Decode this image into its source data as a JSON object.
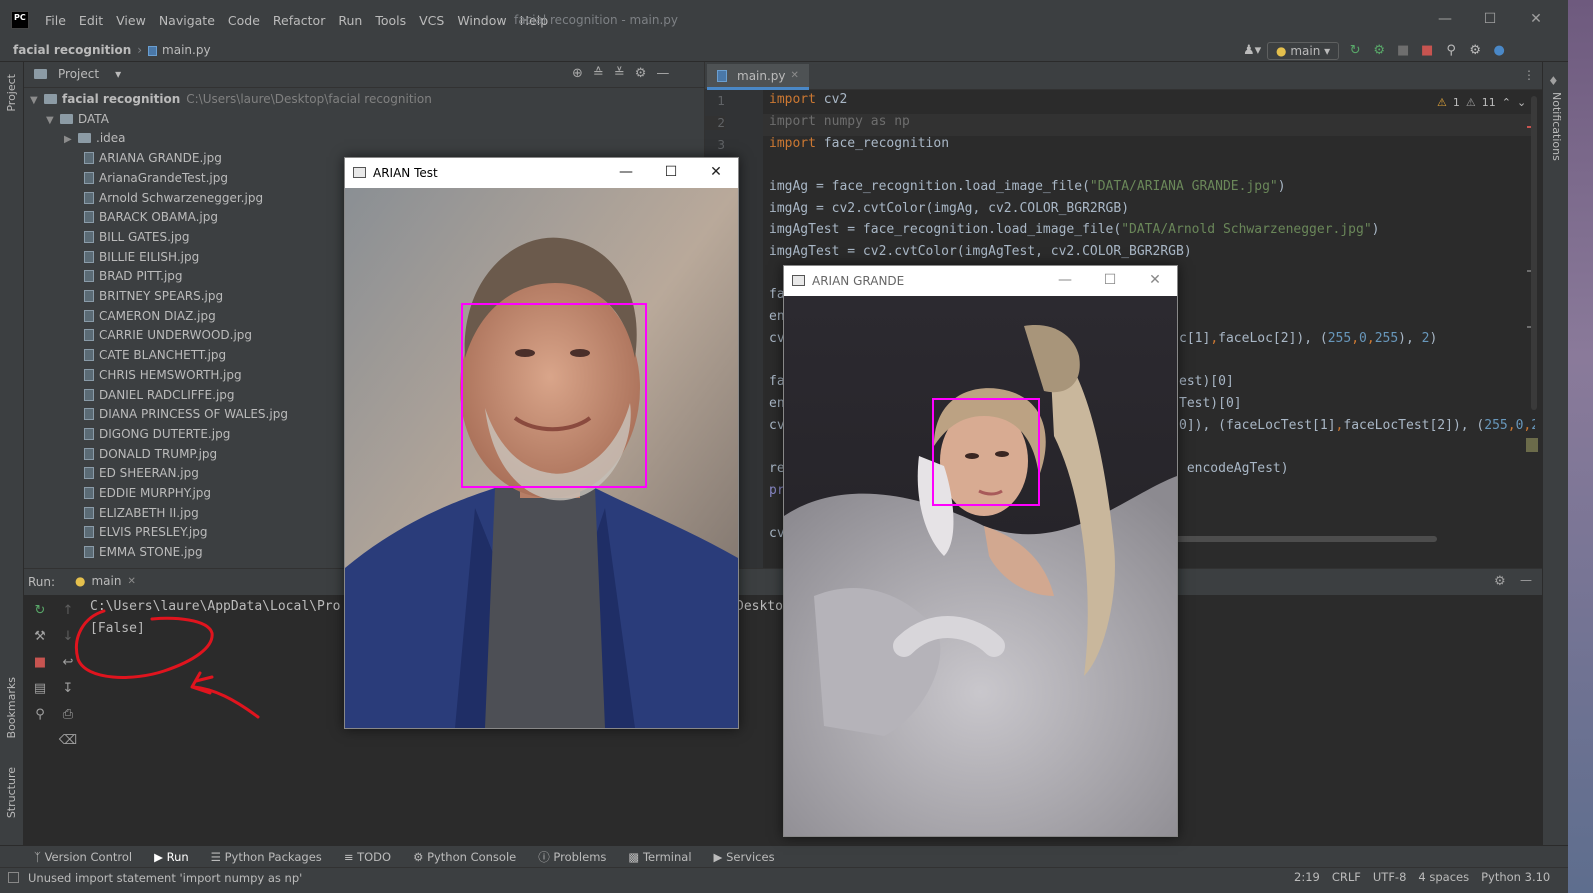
{
  "app": {
    "logo_text": "PC",
    "window_title": "facial recognition - main.py"
  },
  "menu": [
    "File",
    "Edit",
    "View",
    "Navigate",
    "Code",
    "Refactor",
    "Run",
    "Tools",
    "VCS",
    "Window",
    "Help"
  ],
  "breadcrumb": {
    "project": "facial recognition",
    "file": "main.py"
  },
  "toolbar": {
    "run_config": "main"
  },
  "left_strip": {
    "project": "Project",
    "bookmarks": "Bookmarks",
    "structure": "Structure"
  },
  "right_strip": {
    "notifications": "Notifications"
  },
  "project_panel": {
    "title": "Project",
    "root": {
      "name": "facial recognition",
      "path": "C:\\Users\\laure\\Desktop\\facial recognition"
    },
    "data_folder": "DATA",
    "idea_folder": ".idea",
    "files": [
      "ARIANA GRANDE.jpg",
      "ArianaGrandeTest.jpg",
      "Arnold Schwarzenegger.jpg",
      "BARACK OBAMA.jpg",
      "BILL GATES.jpg",
      "BILLIE EILISH.jpg",
      "BRAD PITT.jpg",
      "BRITNEY SPEARS.jpg",
      "CAMERON DIAZ.jpg",
      "CARRIE UNDERWOOD.jpg",
      "CATE BLANCHETT.jpg",
      "CHRIS HEMSWORTH.jpg",
      "DANIEL RADCLIFFE.jpg",
      "DIANA PRINCESS OF WALES.jpg",
      "DIGONG DUTERTE.jpg",
      "DONALD TRUMP.jpg",
      "ED SHEERAN.jpg",
      "EDDIE MURPHY.jpg",
      "ELIZABETH II.jpg",
      "ELVIS PRESLEY.jpg",
      "EMMA STONE.jpg"
    ]
  },
  "editor": {
    "tab": "main.py",
    "warnings": "1",
    "weak_warnings": "11",
    "line_numbers": [
      "1",
      "2",
      "3"
    ],
    "lines": {
      "l1": {
        "kw": "import",
        "rest": " cv2"
      },
      "l2": "import numpy as np",
      "l3": {
        "kw": "import",
        "rest": " face_recognition"
      },
      "l5": {
        "a": "imgAg = face_recognition.load_image_file(",
        "s": "\"DATA/ARIANA GRANDE.jpg\"",
        "b": ")"
      },
      "l6": "imgAg = cv2.cvtColor(imgAg, cv2.COLOR_BGR2RGB)",
      "l7": {
        "a": "imgAgTest = face_recognition.load_image_file(",
        "s": "\"DATA/Arnold Schwarzenegger.jpg\"",
        "b": ")"
      },
      "l8": "imgAgTest = cv2.cvtColor(imgAgTest, cv2.COLOR_BGR2RGB)",
      "l10": "fa",
      "l11": "en",
      "l12": {
        "a": "cv",
        "b": "c[1]",
        "c": ",",
        "d": "faceLoc[2]), (",
        "n1": "255",
        "e": ",",
        "n2": "0",
        "f": ",",
        "n3": "255",
        "g": "), ",
        "n4": "2",
        "h": ")"
      },
      "l14": {
        "a": "fa",
        "b": "est)[0]"
      },
      "l15": {
        "a": "en",
        "b": "Test)[0]"
      },
      "l16": {
        "a": "cv",
        "b": "0]), (faceLocTest[1]",
        "c": ",",
        "d": "faceLocTest[2]), (",
        "n1": "255",
        "e": ",",
        "n2": "0",
        "f": ",",
        "n3": "2"
      },
      "l18": {
        "a": "re",
        "b": " encodeAgTest)"
      },
      "l19": "pr",
      "l21": "cv"
    }
  },
  "run_panel": {
    "label": "Run:",
    "tab": "main",
    "output_line1": "C:\\Users\\laure\\AppData\\Local\\Pro",
    "output_line1_tail": "Deskto",
    "output_line2": "[False]"
  },
  "bottom_tabs": [
    "Version Control",
    "Run",
    "Python Packages",
    "TODO",
    "Python Console",
    "Problems",
    "Terminal",
    "Services"
  ],
  "status": {
    "message": "Unused import statement 'import numpy as np'",
    "position": "2:19",
    "line_sep": "CRLF",
    "encoding": "UTF-8",
    "indent": "4 spaces",
    "interpreter": "Python 3.10"
  },
  "window_test": {
    "title": "ARIAN Test"
  },
  "window_grande": {
    "title": "ARIAN GRANDE"
  },
  "colors": {
    "face_box": "#ff00ff",
    "annotation": "#e0141e",
    "accent": "#4a88c7"
  }
}
